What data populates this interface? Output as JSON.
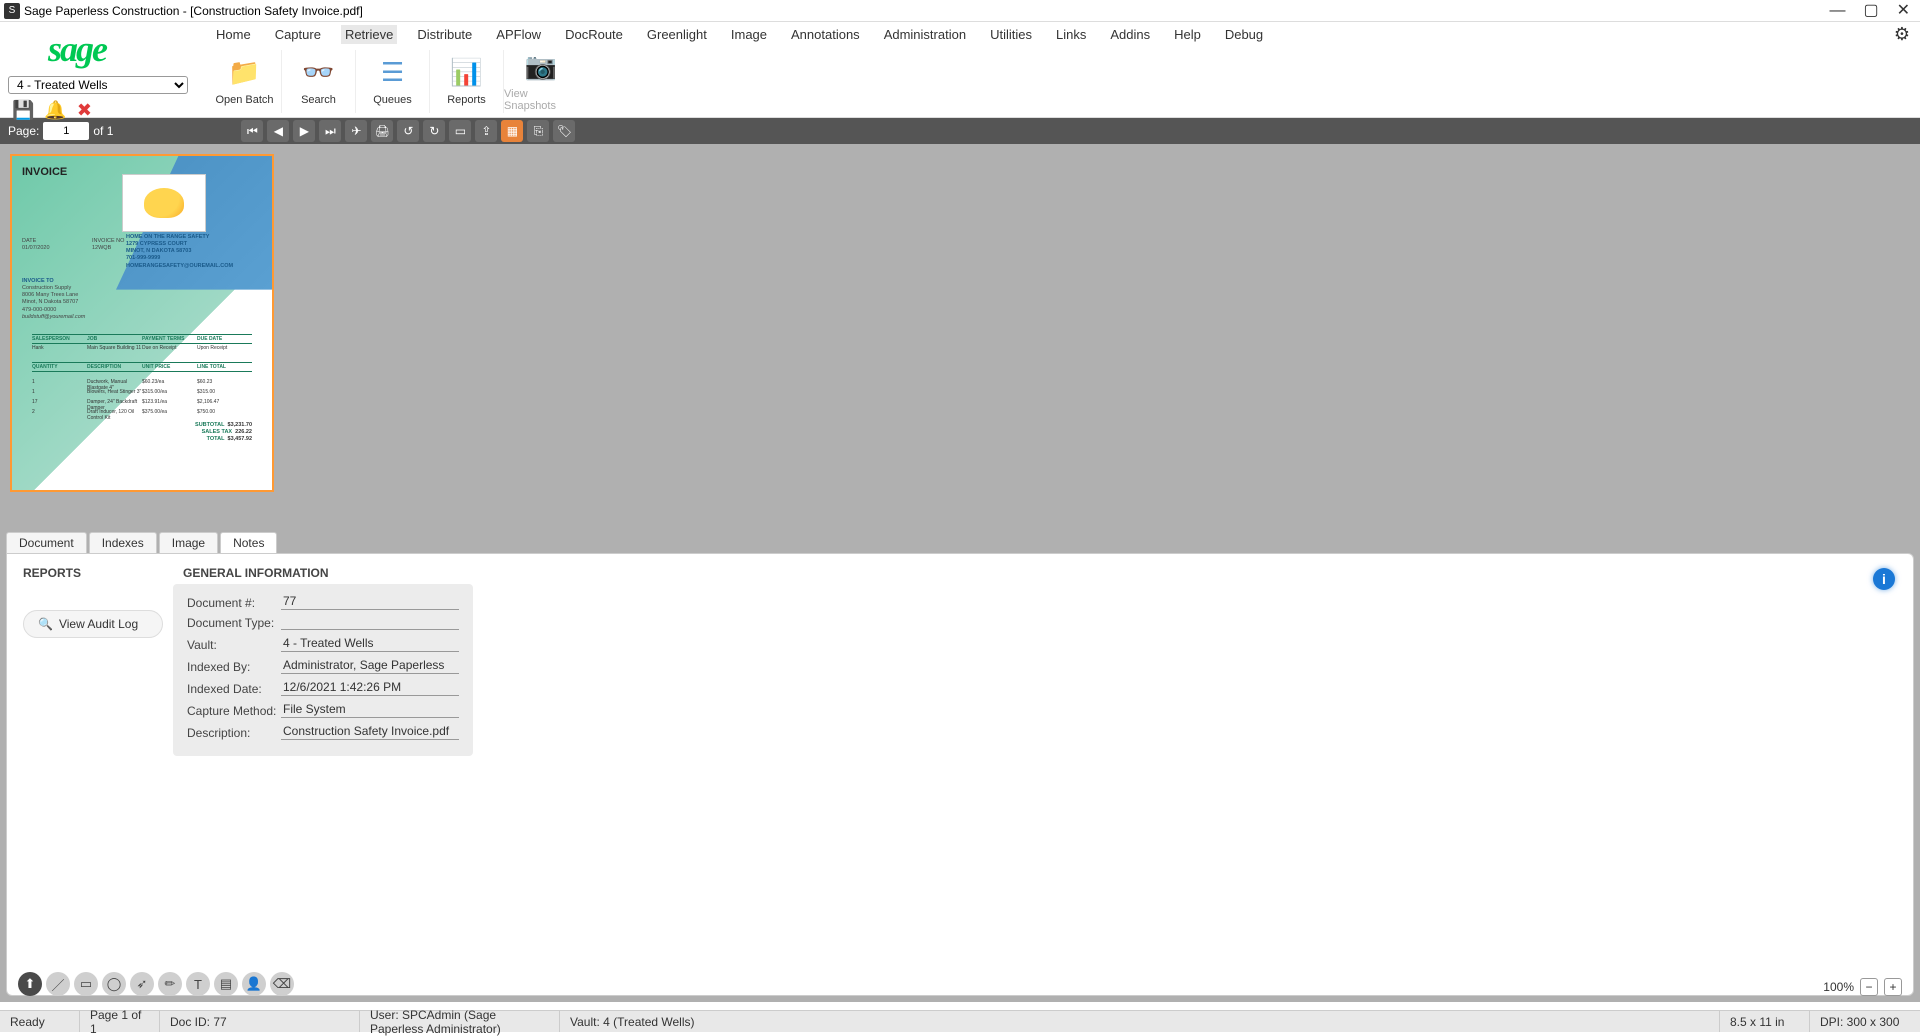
{
  "window": {
    "title": "Sage Paperless Construction - [Construction Safety Invoice.pdf]"
  },
  "brand": "sage",
  "vault_selected": "4 - Treated Wells",
  "mini_icons": {
    "save": "save-icon",
    "bell": "bell-icon",
    "close": "close-red-icon"
  },
  "menu": [
    "Home",
    "Capture",
    "Retrieve",
    "Distribute",
    "APFlow",
    "DocRoute",
    "Greenlight",
    "Image",
    "Annotations",
    "Administration",
    "Utilities",
    "Links",
    "Addins",
    "Help",
    "Debug"
  ],
  "menu_active": "Retrieve",
  "ribbon": [
    {
      "name": "open-batch",
      "label": "Open Batch",
      "icon": "📁"
    },
    {
      "name": "search",
      "label": "Search",
      "icon": "👓"
    },
    {
      "name": "queues",
      "label": "Queues",
      "icon": "☰"
    },
    {
      "name": "reports",
      "label": "Reports",
      "icon": "📊"
    },
    {
      "name": "view-snapshots",
      "label": "View Snapshots",
      "icon": "📷",
      "disabled": true
    }
  ],
  "page_nav": {
    "label": "Page:",
    "current": "1",
    "of": "of  1"
  },
  "invoice": {
    "title": "INVOICE",
    "date_lbl": "DATE",
    "date": "01/07/2020",
    "invno_lbl": "INVOICE NO",
    "invno": "12WQB",
    "vendor": [
      "HOME ON THE RANGE SAFETY",
      "1279 CYPRESS COURT",
      "MINOT, N DAKOTA 58703",
      "701-999-9999",
      "HOMERANGESAFETY@OUREMAIL.COM"
    ],
    "to_lbl": "INVOICE TO",
    "to": [
      "Construction Supply",
      "8006 Many Trees Lane",
      "Minot, N Dakota 58707",
      "479-000-0000",
      "buildstuff@youremail.com"
    ],
    "hdr1": [
      "SALESPERSON",
      "JOB",
      "PAYMENT TERMS",
      "DUE DATE"
    ],
    "row1": [
      "Hank",
      "Main Square Building 11",
      "Due on Receipt",
      "Upon Receipt"
    ],
    "hdr2": [
      "QUANTITY",
      "DESCRIPTION",
      "UNIT PRICE",
      "LINE TOTAL"
    ],
    "lines": [
      [
        "1",
        "Ductwork, Manual Blastgate 4\"",
        "$60.23/ea",
        "$60.23"
      ],
      [
        "1",
        "Blowers, Heat Stinger 3\"",
        "$315.00/ea",
        "$315.00"
      ],
      [
        "17",
        "Damper, 24\" Backdraft Damper",
        "$123.91/ea",
        "$2,106.47"
      ],
      [
        "2",
        "Draft Inducer, 120 Oil Control Kit",
        "$375.00/ea",
        "$750.00"
      ]
    ],
    "totals": {
      "subtotal_lbl": "SUBTOTAL",
      "subtotal": "$3,231.70",
      "tax_lbl": "SALES TAX",
      "tax": "226.22",
      "total_lbl": "TOTAL",
      "total": "$3,457.92"
    }
  },
  "tabs": [
    "Document",
    "Indexes",
    "Image",
    "Notes"
  ],
  "tab_active": "Notes",
  "reports_heading": "REPORTS",
  "audit_label": "View Audit Log",
  "general_heading": "GENERAL INFORMATION",
  "general": [
    {
      "k": "Document #:",
      "v": "77"
    },
    {
      "k": "Document Type:",
      "v": ""
    },
    {
      "k": "Vault:",
      "v": "4 - Treated Wells"
    },
    {
      "k": "Indexed By:",
      "v": "Administrator, Sage Paperless"
    },
    {
      "k": "Indexed Date:",
      "v": "12/6/2021 1:42:26 PM"
    },
    {
      "k": "Capture Method:",
      "v": "File System"
    },
    {
      "k": "Description:",
      "v": "Construction Safety Invoice.pdf"
    }
  ],
  "zoom": "100%",
  "status": {
    "ready": "Ready",
    "page": "Page 1 of 1",
    "docid": "Doc ID: 77",
    "user": "User: SPCAdmin (Sage Paperless Administrator)",
    "vault": "Vault: 4 (Treated Wells)",
    "size": "8.5 x 11 in",
    "dpi": "DPI: 300 x 300"
  }
}
